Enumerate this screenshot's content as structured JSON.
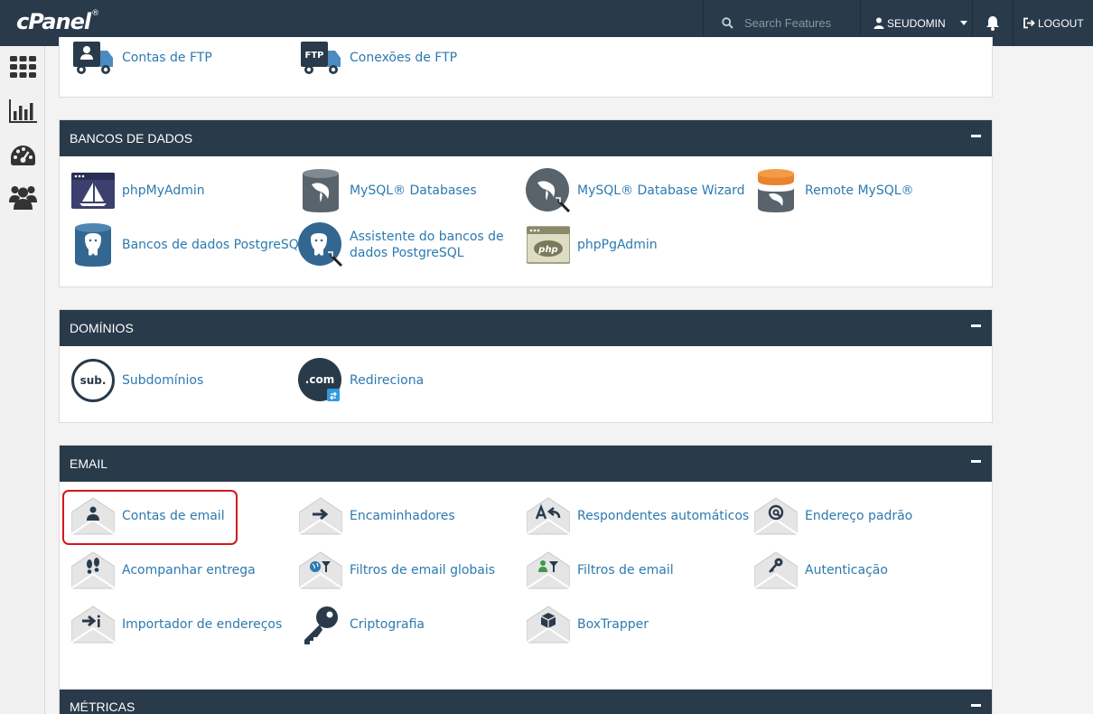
{
  "header": {
    "logo": "cPanel",
    "logo_mark": "®",
    "search_placeholder": "Search Features",
    "username": "SEUDOMIN",
    "logout": "LOGOUT"
  },
  "sections": {
    "files": {
      "items": [
        "Contas de FTP",
        "Conexões de FTP"
      ]
    },
    "databases": {
      "title": "BANCOS DE DADOS",
      "items": [
        "phpMyAdmin",
        "MySQL® Databases",
        "MySQL® Database Wizard",
        "Remote MySQL®",
        "Bancos de dados PostgreSQL",
        "Assistente do bancos de dados PostgreSQL",
        "phpPgAdmin"
      ]
    },
    "domains": {
      "title": "DOMÍNIOS",
      "items": [
        "Subdomínios",
        "Redireciona"
      ]
    },
    "email": {
      "title": "EMAIL",
      "items": [
        "Contas de email",
        "Encaminhadores",
        "Respondentes automáticos",
        "Endereço padrão",
        "Acompanhar entrega",
        "Filtros de email globais",
        "Filtros de email",
        "Autenticação",
        "Importador de endereços",
        "Criptografia",
        "BoxTrapper"
      ]
    },
    "metrics": {
      "title": "MÉTRICAS"
    }
  },
  "icon_text": {
    "ftp": "FTP",
    "php": "php",
    "sub": "sub.",
    "com": ".com"
  },
  "colors": {
    "header_bg": "#293a4a",
    "link": "#2c7ab0",
    "highlight": "#d9141a"
  }
}
